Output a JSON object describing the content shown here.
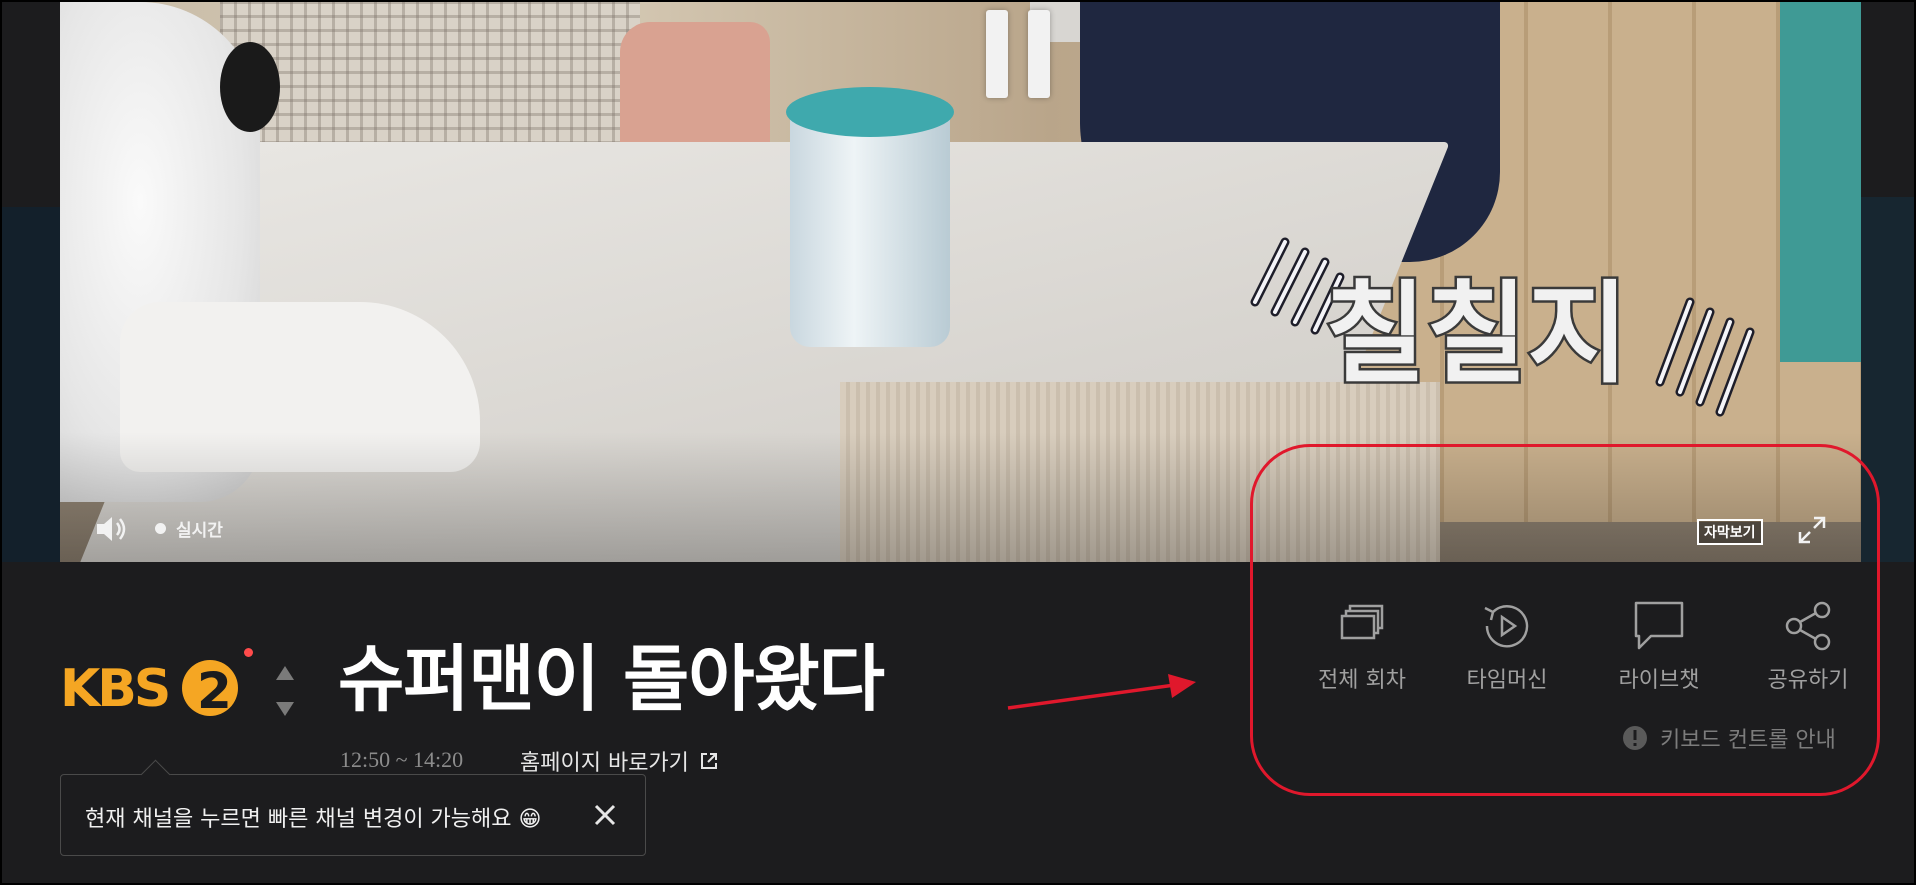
{
  "player": {
    "live_label": "실시간",
    "subtitle_button": "자막보기",
    "caption_glyphs": "칠칠지"
  },
  "channel": {
    "logo_text": "KBS",
    "logo_number": "2",
    "brand_color": "#f5a623"
  },
  "program": {
    "title": "슈퍼맨이 돌아왔다",
    "time_range": "12:50 ~ 14:20",
    "homepage_link": "홈페이지 바로가기"
  },
  "tooltip": {
    "text": "현재 채널을 누르면 빠른 채널 변경이 가능해요 😁"
  },
  "actions": [
    {
      "label": "전체 회차",
      "icon": "episodes-icon"
    },
    {
      "label": "타임머신",
      "icon": "timemachine-icon"
    },
    {
      "label": "라이브챗",
      "icon": "chat-icon"
    },
    {
      "label": "공유하기",
      "icon": "share-icon"
    }
  ],
  "keyboard_guide": "키보드 컨트롤 안내",
  "colors": {
    "background": "#1c1c1e",
    "annotation": "#e0182c",
    "muted_text": "#a0a0a0"
  }
}
